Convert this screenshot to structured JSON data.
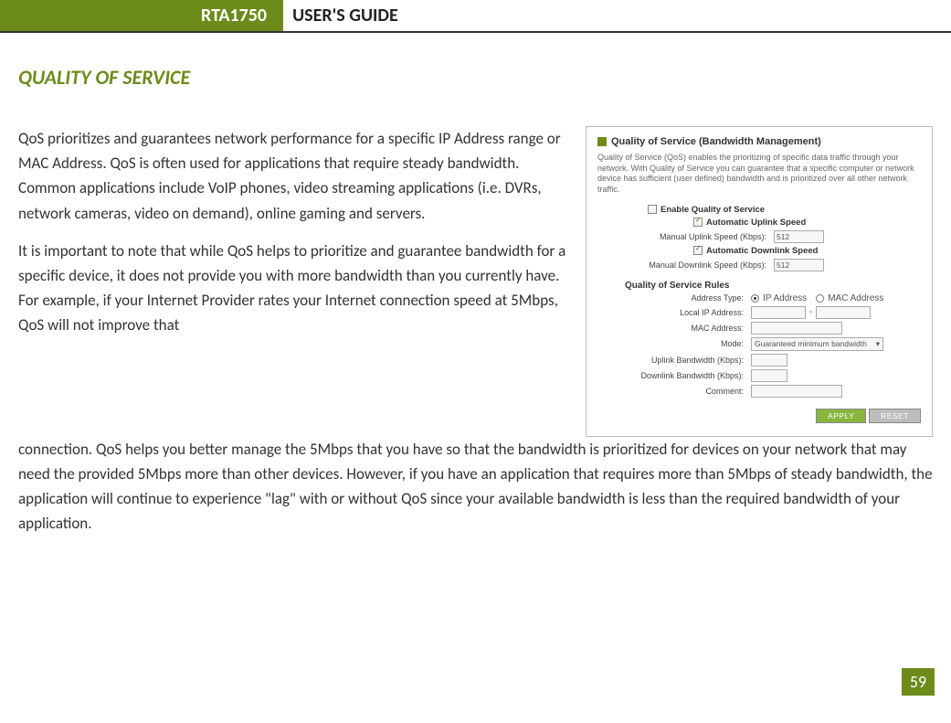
{
  "header": {
    "model": "RTA1750",
    "title": "USER'S GUIDE"
  },
  "section_title": "QUALITY OF SERVICE",
  "paragraphs": {
    "p1": "QoS prioritizes and guarantees network performance for a specific IP Address range or MAC Address. QoS is often used for applications that require steady bandwidth. Common applications include VoIP phones, video streaming applications (i.e. DVRs, network cameras, video on demand), online gaming and servers.",
    "p2_left": "It is important to note that while QoS helps to prioritize and guarantee bandwidth for a specific device, it does not provide you with more bandwidth than you currently have. For example, if your Internet Provider rates your Internet connection speed at 5Mbps, QoS will not improve that",
    "p2_cont": "connection. QoS helps you better manage the 5Mbps that you have so that the bandwidth is prioritized for devices on your network that may need the provided 5Mbps more than other devices. However, if you have an application that requires more than 5Mbps of steady bandwidth, the application will continue to experience \"lag\" with or without QoS since your available bandwidth is less than the required bandwidth of your application."
  },
  "screenshot": {
    "title": "Quality of Service (Bandwidth Management)",
    "desc": "Quality of Service (QoS) enables the prioritizing of specific data traffic through your network. With Quality of Service you can guarantee that a specific computer or network device has sufficient (user defined) bandwidth and is prioritized over all other network traffic.",
    "enable_label": "Enable Quality of Service",
    "auto_uplink": "Automatic Uplink Speed",
    "manual_uplink_label": "Manual Uplink Speed (Kbps):",
    "manual_uplink_value": "512",
    "auto_downlink": "Automatic Downlink Speed",
    "manual_downlink_label": "Manual Downlink Speed (Kbps):",
    "manual_downlink_value": "512",
    "rules_head": "Quality of Service Rules",
    "addr_type_label": "Address Type:",
    "addr_ip": "IP Address",
    "addr_mac": "MAC Address",
    "local_ip_label": "Local IP Address:",
    "mac_label": "MAC Address:",
    "mode_label": "Mode:",
    "mode_value": "Guaranteed minimum bandwidth",
    "up_bw_label": "Uplink Bandwidth (Kbps):",
    "down_bw_label": "Downlink Bandwidth (Kbps):",
    "comment_label": "Comment:",
    "apply": "APPLY",
    "reset": "RESET"
  },
  "page_number": "59"
}
